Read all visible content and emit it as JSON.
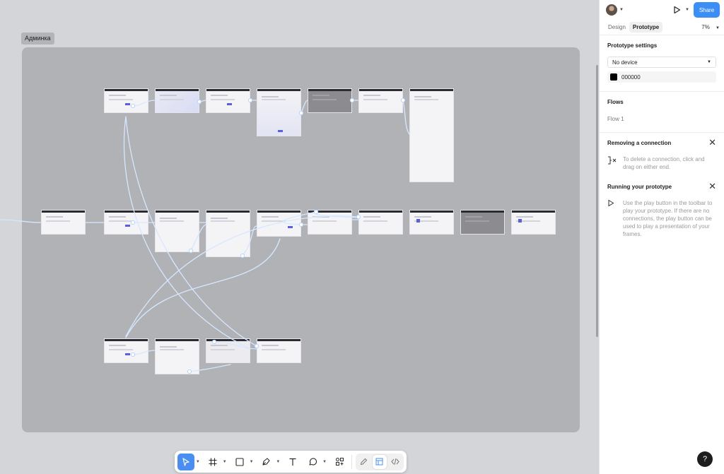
{
  "canvas": {
    "frame_label": "Админка"
  },
  "toolbar": {
    "tools": [
      "move-tool",
      "frame-tool",
      "shape-tool",
      "pen-tool",
      "text-tool",
      "comment-tool",
      "actions-tool"
    ],
    "dev_modes": [
      "draw-mode",
      "design-mode",
      "dev-mode"
    ]
  },
  "panel": {
    "share_label": "Share",
    "tabs": [
      {
        "label": "Design"
      },
      {
        "label": "Prototype"
      }
    ],
    "zoom": "7%",
    "prototype_settings": {
      "title": "Prototype settings",
      "device": "No device",
      "background_color": "000000"
    },
    "flows": {
      "title": "Flows",
      "items": [
        "Flow 1"
      ]
    },
    "removing_connection": {
      "title": "Removing a connection",
      "text": "To delete a connection, click and drag on either end."
    },
    "running_prototype": {
      "title": "Running your prototype",
      "text": "Use the play button in the toolbar to play your prototype. If there are no connections, the play button can be used to play a presentation of your frames."
    },
    "help_label": "?"
  },
  "colors": {
    "accent": "#3b8ef5",
    "canvas": "#d3d5d9",
    "section": "#b0b2b5",
    "wire": "#cfe3ff"
  }
}
